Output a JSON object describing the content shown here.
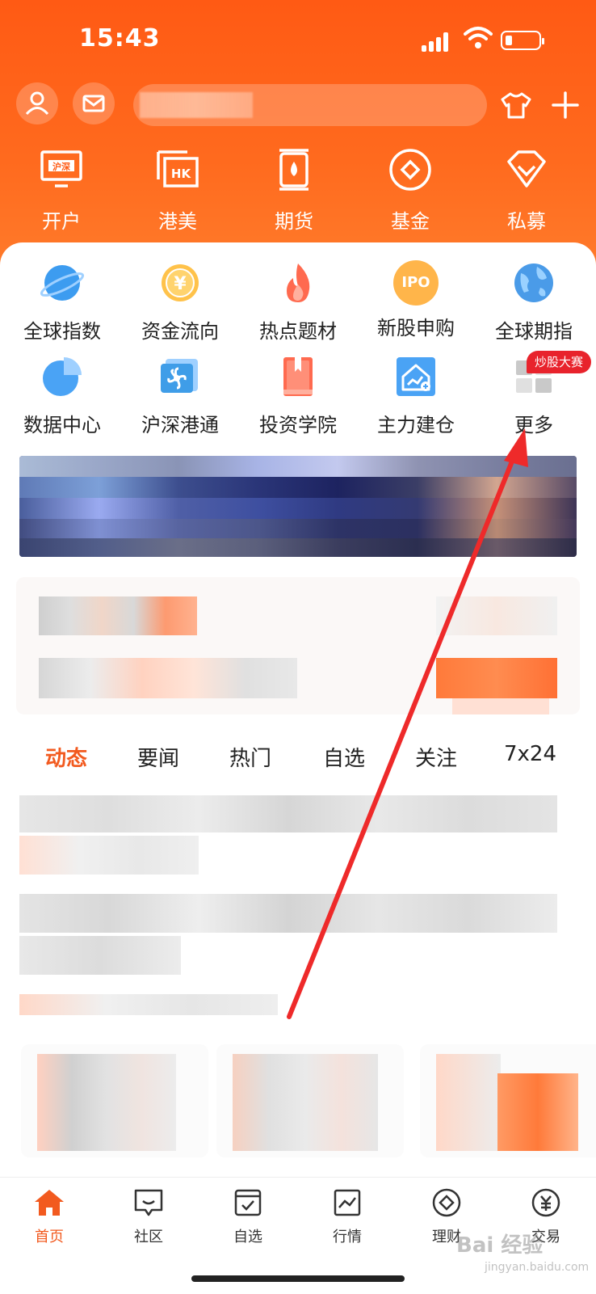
{
  "status_bar": {
    "time": "15:43"
  },
  "top_shortcuts": [
    {
      "label": "开户",
      "icon": "hu-shen-card-icon"
    },
    {
      "label": "港美",
      "icon": "hk-card-icon"
    },
    {
      "label": "期货",
      "icon": "futures-icon"
    },
    {
      "label": "基金",
      "icon": "fund-diamond-icon"
    },
    {
      "label": "私募",
      "icon": "gem-icon"
    }
  ],
  "feature_grid": [
    {
      "label": "全球指数",
      "icon": "planet-icon"
    },
    {
      "label": "资金流向",
      "icon": "yen-coin-icon"
    },
    {
      "label": "热点题材",
      "icon": "fire-icon"
    },
    {
      "label": "新股申购",
      "icon": "ipo-icon",
      "icon_text": "IPO"
    },
    {
      "label": "全球期指",
      "icon": "globe-icon"
    },
    {
      "label": "数据中心",
      "icon": "pie-chart-icon"
    },
    {
      "label": "沪深港通",
      "icon": "hk-flower-icon"
    },
    {
      "label": "投资学院",
      "icon": "book-icon"
    },
    {
      "label": "主力建仓",
      "icon": "house-chart-icon"
    },
    {
      "label": "更多",
      "icon": "more-grid-icon",
      "badge": "炒股大赛"
    }
  ],
  "feed_tabs": [
    "动态",
    "要闻",
    "热门",
    "自选",
    "关注",
    "7x24"
  ],
  "bottom_nav": [
    {
      "label": "首页",
      "icon": "home-icon",
      "active": true
    },
    {
      "label": "社区",
      "icon": "chat-icon"
    },
    {
      "label": "自选",
      "icon": "checkbox-icon"
    },
    {
      "label": "行情",
      "icon": "chart-line-icon"
    },
    {
      "label": "理财",
      "icon": "diamond-icon"
    },
    {
      "label": "交易",
      "icon": "yen-icon"
    }
  ],
  "watermark": {
    "brand": "Bai 经验",
    "url": "jingyan.baidu.com"
  },
  "colors": {
    "brand": "#ff5a14",
    "accent": "#f25a1f",
    "badge": "#e8232c"
  }
}
